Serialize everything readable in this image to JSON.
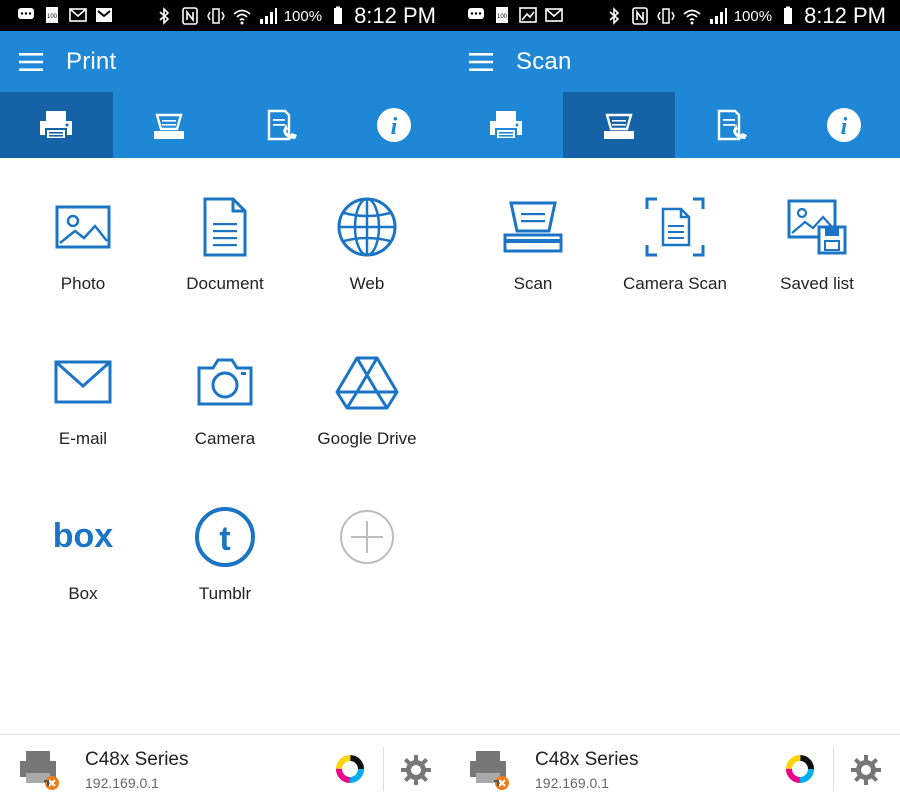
{
  "status_bar": {
    "battery_pct": "100%",
    "time": "8:12 PM"
  },
  "panels": [
    {
      "title": "Print",
      "active_tab": "print",
      "tabs": [
        "print-icon",
        "scan-icon",
        "fax-icon",
        "info-icon"
      ],
      "items": [
        {
          "label": "Photo",
          "icon": "photo-icon"
        },
        {
          "label": "Document",
          "icon": "document-icon"
        },
        {
          "label": "Web",
          "icon": "web-icon"
        },
        {
          "label": "E-mail",
          "icon": "email-icon"
        },
        {
          "label": "Camera",
          "icon": "camera-icon"
        },
        {
          "label": "Google Drive",
          "icon": "google-drive-icon"
        },
        {
          "label": "Box",
          "icon": "box-icon"
        },
        {
          "label": "Tumblr",
          "icon": "tumblr-icon"
        },
        {
          "label": "",
          "icon": "add-icon"
        }
      ],
      "printer": {
        "name": "C48x Series",
        "ip": "192.169.0.1"
      }
    },
    {
      "title": "Scan",
      "active_tab": "scan",
      "tabs": [
        "print-icon",
        "scan-icon",
        "fax-icon",
        "info-icon"
      ],
      "items": [
        {
          "label": "Scan",
          "icon": "scan-icon"
        },
        {
          "label": "Camera Scan",
          "icon": "camera-scan-icon"
        },
        {
          "label": "Saved list",
          "icon": "saved-list-icon"
        }
      ],
      "printer": {
        "name": "C48x Series",
        "ip": "192.169.0.1"
      }
    }
  ],
  "colors": {
    "primary": "#1e88d7",
    "primary_dark": "#1662a6",
    "icon_blue": "#1b74c4"
  }
}
